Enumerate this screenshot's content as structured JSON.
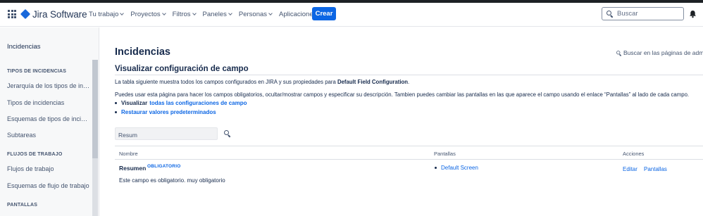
{
  "brand": {
    "name": "Jira Software",
    "accent": "#1868db"
  },
  "nav": {
    "items": [
      "Tu trabajo",
      "Proyectos",
      "Filtros",
      "Paneles",
      "Personas",
      "Aplicaciones"
    ],
    "create_label": "Crear"
  },
  "search": {
    "placeholder": "Buscar"
  },
  "icons": {
    "app_switcher": "grid-icon",
    "search": "search-icon",
    "notifications": "bell-icon"
  },
  "sidebar": {
    "title": "Incidencias",
    "section_issue_types": "TIPOS DE INCIDENCIAS",
    "issue_type_items": [
      "Jerarquía de los tipos de inci...",
      "Tipos de incidencias",
      "Esquemas de tipos de incide...",
      "Subtareas"
    ],
    "section_workflows": "FLUJOS DE TRABAJO",
    "workflow_items": [
      "Flujos de trabajo",
      "Esquemas de flujo de trabajo"
    ],
    "section_screens": "PANTALLAS"
  },
  "main": {
    "title": "Incidencias",
    "admin_search": "Buscar en las páginas de admin",
    "section_title": "Visualizar configuración de campo",
    "desc_prefix": "La tabla siguiente muestra todos los campos configurados en JIRA y sus propiedades para ",
    "desc_config_name": "Default Field Configuration",
    "desc_suffix": ".",
    "help_text": "Puedes usar esta página para hacer los campos obligatorios, ocultar/mostrar campos y especificar su descripción. Tambien puedes cambiar las pantallas en las que aparece el campo usando el enlace “Pantallas” al lado de cada campo.",
    "link_view_prefix": "Visualizar",
    "link_view_all": "todas las configuraciones de campo",
    "link_restore": "Restaurar valores predeterminados",
    "filter_value": "Resum"
  },
  "table": {
    "headers": {
      "name": "Nombre",
      "screens": "Pantallas",
      "actions": "Acciones"
    },
    "rows": [
      {
        "name": "Resumen",
        "badge": "OBLIGATORIO",
        "description": "Este campo es obligatorio. muy obligatorio",
        "screens": [
          "Default Screen"
        ],
        "actions": [
          "Editar",
          "Pantallas"
        ]
      }
    ]
  }
}
